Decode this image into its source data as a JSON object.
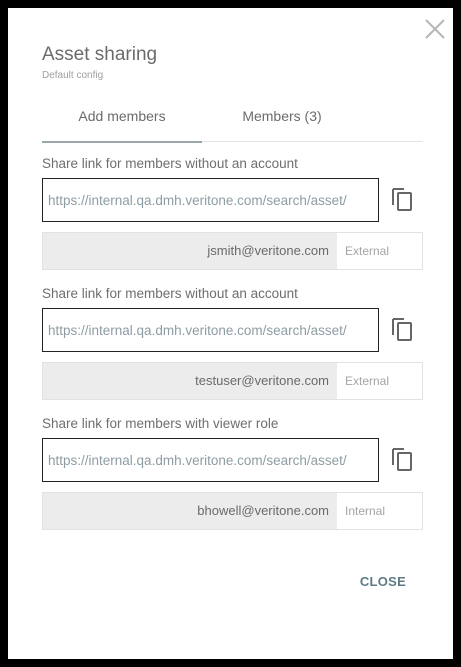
{
  "dialog": {
    "title": "Asset sharing",
    "subtitle": "Default config",
    "close_icon": "close-icon",
    "close_label": "CLOSE"
  },
  "tabs": [
    {
      "label": "Add members",
      "active": true
    },
    {
      "label": "Members (3)",
      "active": false
    }
  ],
  "shares": [
    {
      "label": "Share link for members without an account",
      "link": "https://internal.qa.dmh.veritone.com/search/asset/",
      "email": "jsmith@veritone.com",
      "type": "External"
    },
    {
      "label": "Share link for members without an account",
      "link": "https://internal.qa.dmh.veritone.com/search/asset/",
      "email": "testuser@veritone.com",
      "type": "External"
    },
    {
      "label": "Share link for members with viewer role",
      "link": "https://internal.qa.dmh.veritone.com/search/asset/",
      "email": "bhowell@veritone.com",
      "type": "Internal"
    }
  ],
  "icons": {
    "copy": "copy-icon",
    "close": "close-icon"
  },
  "colors": {
    "accent": "#5f7a85",
    "tab_indicator": "#9aa7ab",
    "email_bg": "#ececec"
  }
}
